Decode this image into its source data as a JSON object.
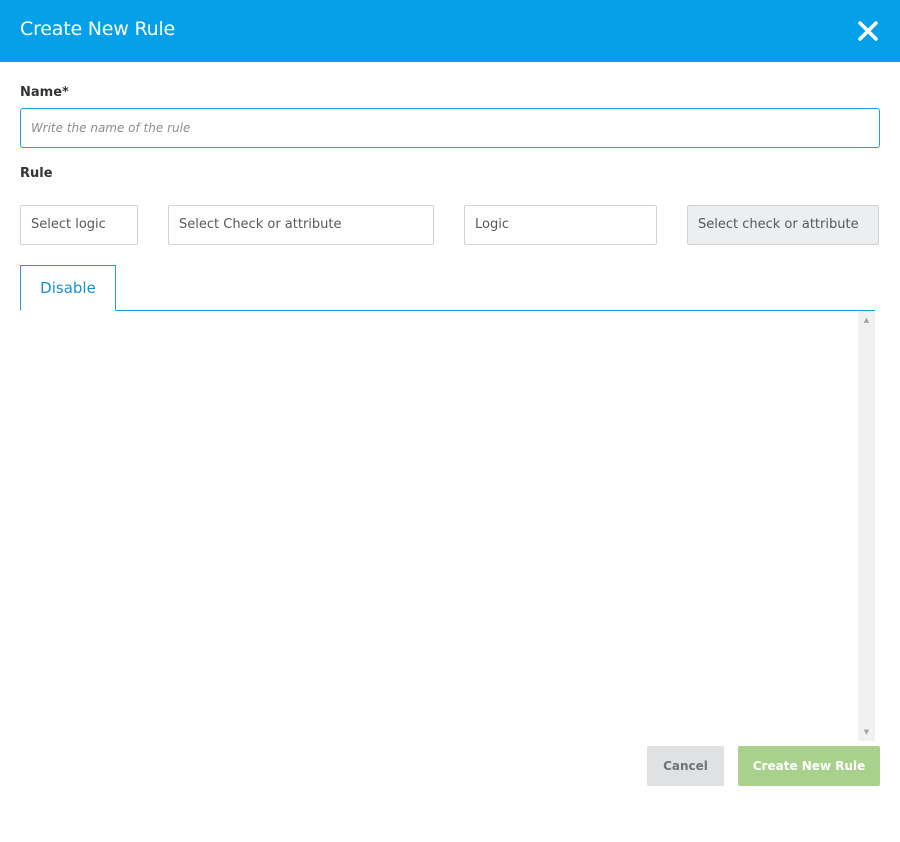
{
  "dialog": {
    "title": "Create New Rule",
    "close_icon": "close-icon",
    "header_color": "#06a0e8"
  },
  "form": {
    "name_label": "Name*",
    "name_placeholder": "Write the name of the rule",
    "name_value": "",
    "rule_label": "Rule",
    "rule_fields": [
      {
        "text": "Select logic",
        "disabled": false
      },
      {
        "text": "Select Check or attribute",
        "disabled": false
      },
      {
        "text": "Logic",
        "disabled": false
      },
      {
        "text": "Select check or attribute",
        "disabled": true
      }
    ]
  },
  "tabs": [
    {
      "label": "Disable",
      "active": true
    }
  ],
  "actions": {
    "cancel_label": "Cancel",
    "create_label": "Create New Rule",
    "create_color": "#a9d08c"
  }
}
